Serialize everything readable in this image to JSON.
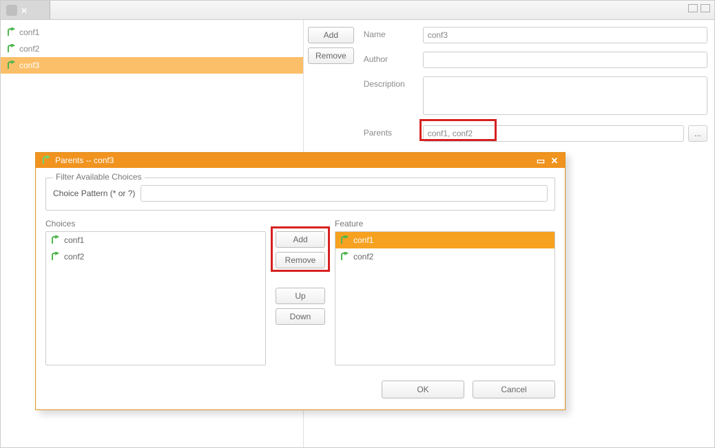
{
  "left_tree": {
    "items": [
      {
        "label": "conf1",
        "selected": false
      },
      {
        "label": "conf2",
        "selected": false
      },
      {
        "label": "conf3",
        "selected": true
      }
    ]
  },
  "form": {
    "add_btn": "Add",
    "remove_btn": "Remove",
    "name_label": "Name",
    "name_value": "conf3",
    "author_label": "Author",
    "author_value": "",
    "description_label": "Description",
    "description_value": "",
    "parents_label": "Parents",
    "parents_value": "conf1, conf2",
    "ellipsis_label": "..."
  },
  "dialog": {
    "title": "Parents -- conf3",
    "filter_legend": "Filter Available Choices",
    "choice_pattern_label": "Choice Pattern (* or ?)",
    "choice_pattern_value": "",
    "choices_label": "Choices",
    "feature_label": "Feature",
    "choices": [
      {
        "label": "conf1",
        "selected": false
      },
      {
        "label": "conf2",
        "selected": false
      }
    ],
    "feature": [
      {
        "label": "conf1",
        "selected": true
      },
      {
        "label": "conf2",
        "selected": false
      }
    ],
    "add_btn": "Add",
    "remove_btn": "Remove",
    "up_btn": "Up",
    "down_btn": "Down",
    "ok_btn": "OK",
    "cancel_btn": "Cancel"
  }
}
